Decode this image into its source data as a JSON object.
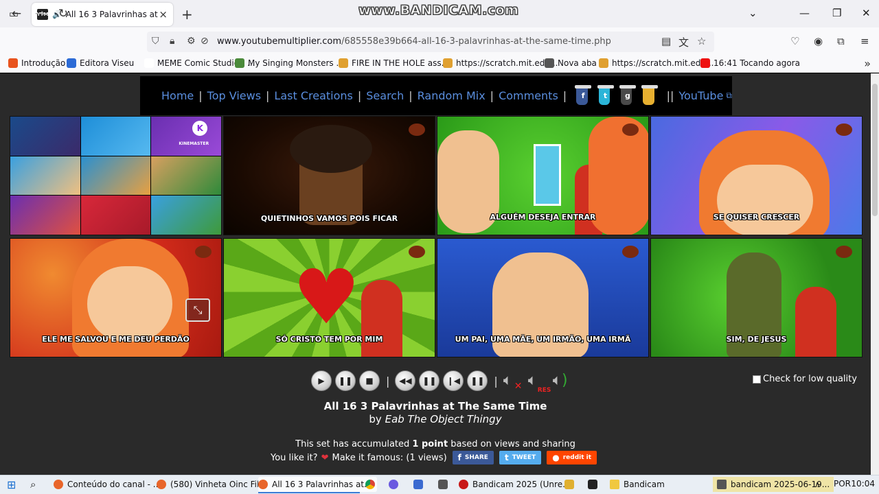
{
  "browser": {
    "tab_title": "All 16 3 Palavrinhas at The S",
    "tab_favicon": "YTM",
    "watermark": "www.BANDICAM.com",
    "url_domain": "www.youtubemultiplier.com",
    "url_path": "/685558e39b664-all-16-3-palavrinhas-at-the-same-time.php"
  },
  "bookmarks": [
    {
      "label": "Introdução",
      "color": "#e8531e"
    },
    {
      "label": "Editora Viseu",
      "color": "#2c6bd6"
    },
    {
      "label": "MEME Comic Studio - ...",
      "color": "#ffffff"
    },
    {
      "label": "My Singing Monsters ...",
      "color": "#4a8a3a"
    },
    {
      "label": "FIRE IN THE HOLE ass...",
      "color": "#e0a030"
    },
    {
      "label": "https://scratch.mit.edu...",
      "color": "#e0a030"
    },
    {
      "label": "Nova aba",
      "color": "#555555"
    },
    {
      "label": "https://scratch.mit.edu...",
      "color": "#e0a030"
    },
    {
      "label": "16:41  Tocando agora",
      "color": "#ee1111"
    }
  ],
  "site_nav": {
    "links": [
      "Home",
      "Top Views",
      "Last Creations",
      "Search",
      "Random Mix",
      "Comments"
    ],
    "youtube": "YouTube"
  },
  "videos": [
    {
      "caption": "",
      "kind": "mosaic"
    },
    {
      "caption": "QUIETINHOS VAMOS POIS FICAR"
    },
    {
      "caption": "ALGUÉM DESEJA ENTRAR"
    },
    {
      "caption": "SE QUISER CRESCER"
    },
    {
      "caption": "ELE ME SALVOU E ME DEU PERDÃO"
    },
    {
      "caption": "SÓ CRISTO TEM POR MIM"
    },
    {
      "caption": "UM PAI, UMA MÃE, UM IRMÃO, UMA IRMÃ"
    },
    {
      "caption": "SIM, DE JESUS"
    }
  ],
  "mosaic_text": "KINEMASTER",
  "low_quality_label": "Check for low quality",
  "set": {
    "title": "All 16 3 Palavrinhas at The Same Time",
    "by": "by",
    "author": "Eab The Object Thingy",
    "stats_prefix": "This set has accumulated",
    "points": "1 point",
    "stats_suffix": "based on views and sharing",
    "like_prefix": "You like it?",
    "like_suffix": "Make it famous: (1 views)"
  },
  "share_buttons": [
    {
      "label": "SHARE",
      "color": "#3b5998"
    },
    {
      "label": "TWEET",
      "color": "#55acee"
    },
    {
      "label": "reddit it",
      "color": "#ff4500"
    }
  ],
  "taskbar": {
    "items": [
      "Conteúdo do canal - ...",
      "(580) Vinheta Oinc Fil...",
      "All 16 3 Palavrinhas at...",
      "Bandicam 2025 (Unre...",
      "Bandicam",
      "bandicam 2025-06-19..."
    ],
    "lang": "POR",
    "time": "10:04"
  }
}
